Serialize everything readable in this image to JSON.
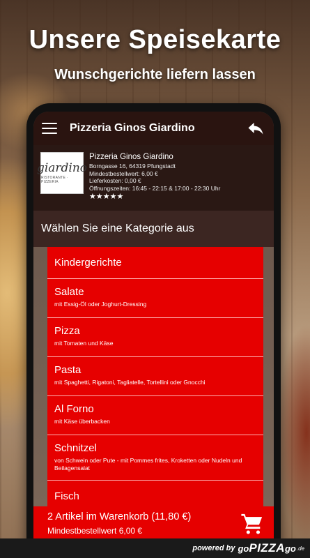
{
  "promo": {
    "headline": "Unsere Speisekarte",
    "subheadline": "Wunschgerichte liefern lassen"
  },
  "app": {
    "title": "Pizzeria Ginos Giardino"
  },
  "restaurant": {
    "logo_word": "giardino",
    "logo_sub": "RISTORANTE · PIZZERIA",
    "name": "Pizzeria Ginos Giardino",
    "address": "Borngasse 16, 64319 Pfungstadt",
    "min_order": "Mindestbestellwert: 6,00 €",
    "delivery_cost": "Lieferkosten: 0,00 €",
    "hours": "Öffnungszeiten: 16:45 - 22:15 & 17:00 - 22:30 Uhr",
    "rating": 5,
    "stars": "★★★★★"
  },
  "category_header": "Wählen Sie eine Kategorie aus",
  "categories": [
    {
      "name": "Kindergerichte",
      "desc": ""
    },
    {
      "name": "Salate",
      "desc": "mit Essig-Öl oder Joghurt-Dressing"
    },
    {
      "name": "Pizza",
      "desc": "mit Tomaten und Käse"
    },
    {
      "name": "Pasta",
      "desc": "mit Spaghetti, Rigatoni, Tagliatelle, Tortellini oder Gnocchi"
    },
    {
      "name": "Al Forno",
      "desc": "mit Käse überbacken"
    },
    {
      "name": "Schnitzel",
      "desc": "von Schwein oder Pute - mit Pommes frites, Kroketten oder Nudeln und Beilagensalat"
    },
    {
      "name": "Fisch",
      "desc": ""
    }
  ],
  "cart": {
    "summary": "2 Artikel im Warenkorb (11,80 €)",
    "min_order": "Mindestbestellwert 6,00 €"
  },
  "footer": {
    "powered_by": "powered by",
    "brand_go": "go",
    "brand_pizza": "PIZZA",
    "brand_go2": "go",
    "brand_tld": ".de"
  },
  "colors": {
    "accent_red": "#e60000",
    "appbar": "#2a1410"
  }
}
